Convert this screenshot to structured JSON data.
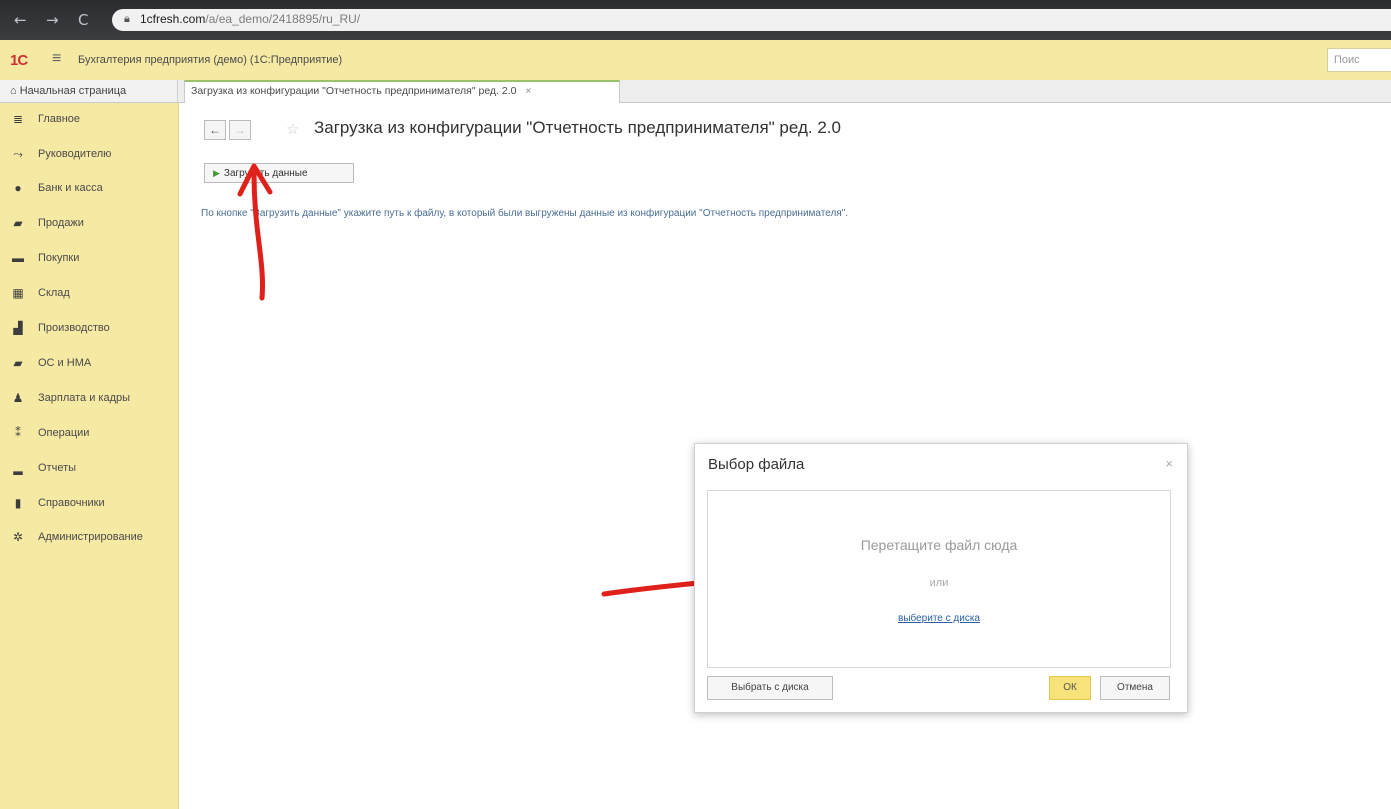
{
  "browser": {
    "back_icon": "←",
    "forward_icon": "→",
    "reload_icon": "C",
    "url_host": "1cfresh.com",
    "url_path": "/a/ea_demo/2418895/ru_RU/"
  },
  "header": {
    "logo": "1С",
    "title": "Бухгалтерия предприятия (демо)  (1С:Предприятие)",
    "search_placeholder": "Поис"
  },
  "tabs": {
    "home": "Начальная страница",
    "doc": "Загрузка из конфигурации \"Отчетность предпринимателя\" ред. 2.0",
    "close": "×"
  },
  "sidebar": {
    "items": [
      {
        "label": "Главное",
        "icon": "≣"
      },
      {
        "label": "Руководителю",
        "icon": "⤳"
      },
      {
        "label": "Банк и касса",
        "icon": "●"
      },
      {
        "label": "Продажи",
        "icon": "▰"
      },
      {
        "label": "Покупки",
        "icon": "▬"
      },
      {
        "label": "Склад",
        "icon": "▦"
      },
      {
        "label": "Производство",
        "icon": "▟"
      },
      {
        "label": "ОС и НМА",
        "icon": "▰"
      },
      {
        "label": "Зарплата и кадры",
        "icon": "♟"
      },
      {
        "label": "Операции",
        "icon": "⁑"
      },
      {
        "label": "Отчеты",
        "icon": "▂"
      },
      {
        "label": "Справочники",
        "icon": "▮"
      },
      {
        "label": "Администрирование",
        "icon": "✲"
      }
    ]
  },
  "main": {
    "title": "Загрузка из конфигурации \"Отчетность предпринимателя\" ред. 2.0",
    "load_button": "Загрузить данные",
    "hint": "По кнопке \"Загрузить данные\" укажите путь к файлу, в который были выгружены данные из конфигурации \"Отчетность предпринимателя\"."
  },
  "dialog": {
    "title": "Выбор файла",
    "close": "×",
    "drop_text": "Перетащите файл сюда",
    "or_text": "или",
    "choose_link": "выберите с диска",
    "choose_button": "Выбрать с диска",
    "ok_button": "ОК",
    "cancel_button": "Отмена"
  },
  "colors": {
    "header_bg": "#f6e9a4",
    "sidebar_bg": "#f6e9a4",
    "annotation_arrow": "#e0201a"
  }
}
